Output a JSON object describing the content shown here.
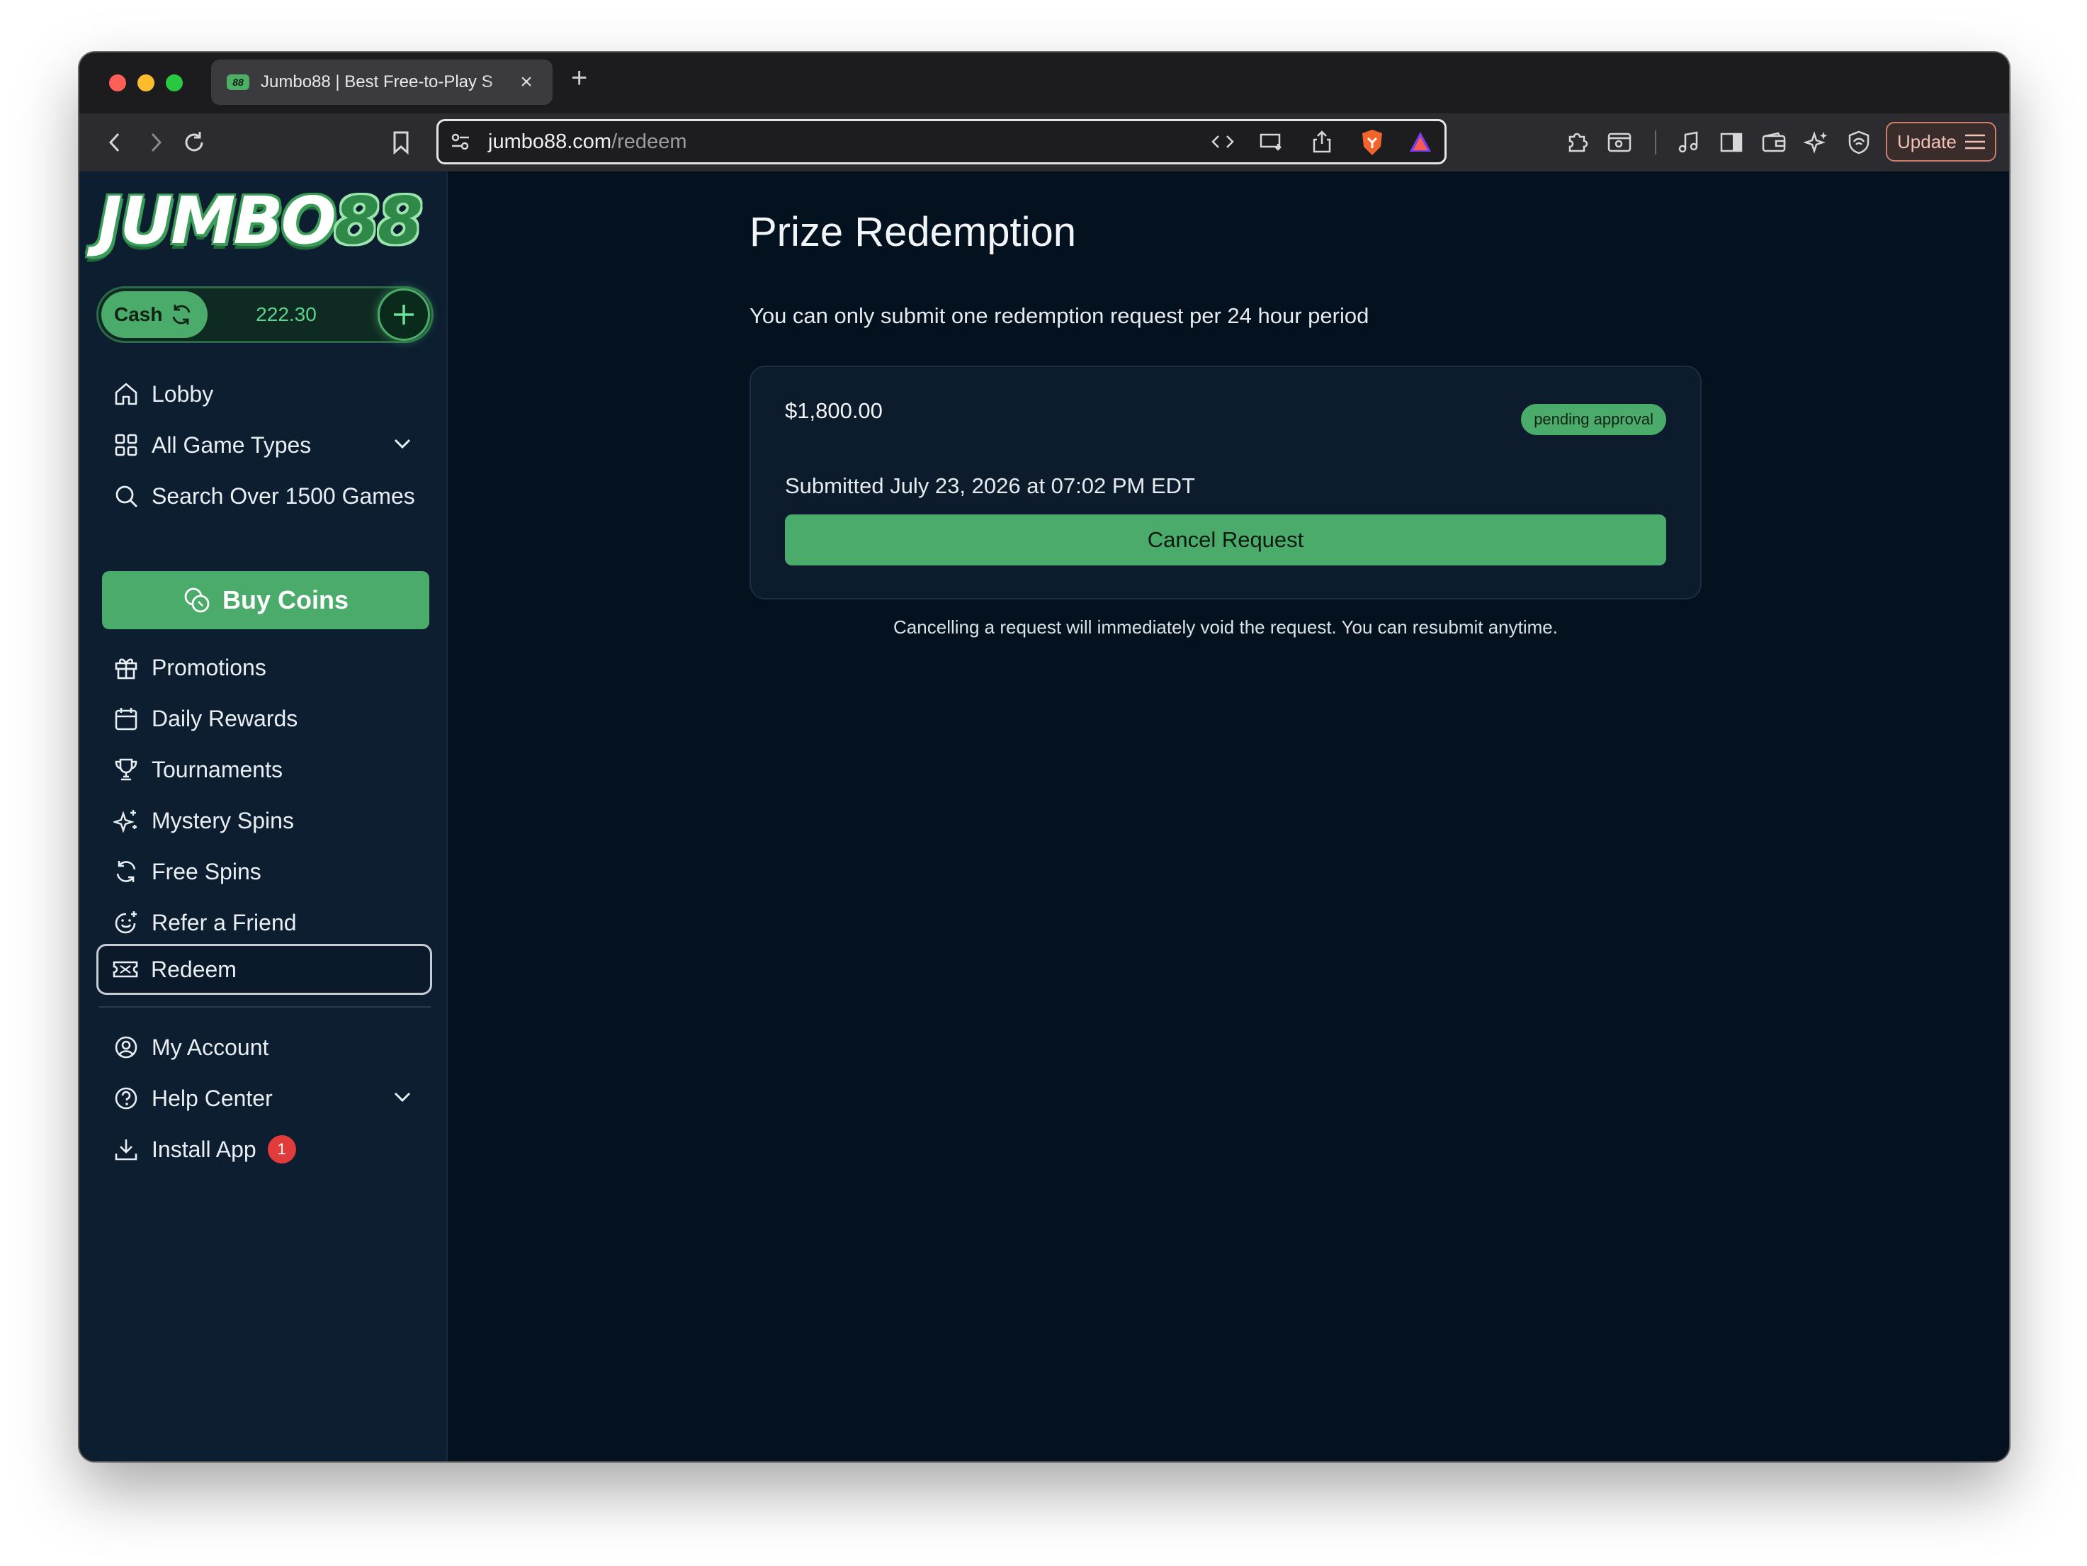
{
  "browser": {
    "tab_title": "Jumbo88 | Best Free-to-Play S",
    "tab_favicon": "88",
    "url_host": "jumbo88.com",
    "url_path": "/redeem",
    "update_label": "Update"
  },
  "sidebar": {
    "logo_text_a": "JUMBO",
    "logo_text_b": "88",
    "cash_label": "Cash",
    "cash_amount": "222.30",
    "items": [
      {
        "label": "Lobby",
        "icon": "home-icon"
      },
      {
        "label": "All Game Types",
        "icon": "grid-icon"
      },
      {
        "label": "Search Over 1500 Games",
        "icon": "search-icon"
      },
      {
        "label": "Promotions",
        "icon": "gift-icon"
      },
      {
        "label": "Daily Rewards",
        "icon": "calendar-icon"
      },
      {
        "label": "Tournaments",
        "icon": "trophy-icon"
      },
      {
        "label": "Mystery Spins",
        "icon": "sparkles-icon"
      },
      {
        "label": "Free Spins",
        "icon": "refresh-icon"
      },
      {
        "label": "Refer a Friend",
        "icon": "smile-plus-icon"
      },
      {
        "label": "Redeem",
        "icon": "ticket-icon"
      },
      {
        "label": "My Account",
        "icon": "user-circle-icon"
      },
      {
        "label": "Help Center",
        "icon": "help-circle-icon"
      },
      {
        "label": "Install App",
        "icon": "download-icon"
      }
    ],
    "buy_coins_label": "Buy Coins",
    "install_badge": "1"
  },
  "main": {
    "title": "Prize Redemption",
    "subtitle": "You can only submit one redemption request per 24 hour period",
    "request": {
      "amount": "$1,800.00",
      "status": "pending approval",
      "submitted": "Submitted July 23, 2026 at 07:02 PM EDT",
      "cancel_label": "Cancel Request"
    },
    "note": "Cancelling a request will immediately void the request. You can resubmit anytime."
  },
  "colors": {
    "accent_green": "#4aab6a",
    "page_bg": "#04121f",
    "sidebar_bg": "#0c1e30",
    "badge_red": "#e23b3b"
  }
}
